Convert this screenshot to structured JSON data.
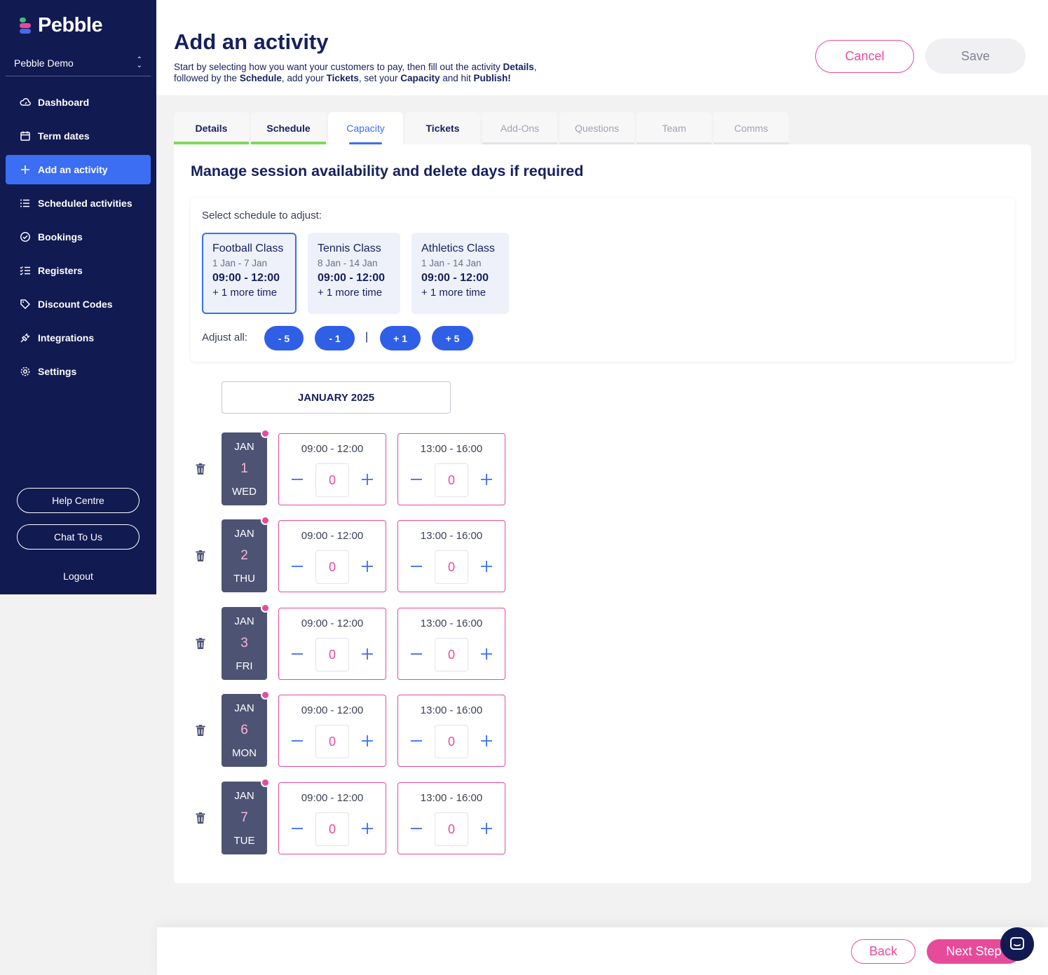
{
  "sidebar": {
    "logo_text": "Pebble",
    "org_name": "Pebble Demo",
    "items": [
      {
        "label": "Dashboard",
        "icon": "cloud-icon"
      },
      {
        "label": "Term dates",
        "icon": "calendar-icon"
      },
      {
        "label": "Add an activity",
        "icon": "plus-icon"
      },
      {
        "label": "Scheduled activities",
        "icon": "list-icon"
      },
      {
        "label": "Bookings",
        "icon": "check-circle-icon"
      },
      {
        "label": "Registers",
        "icon": "checklist-icon"
      },
      {
        "label": "Discount Codes",
        "icon": "tag-icon"
      },
      {
        "label": "Integrations",
        "icon": "plug-icon"
      },
      {
        "label": "Settings",
        "icon": "gear-icon"
      }
    ],
    "help_label": "Help Centre",
    "chat_label": "Chat To Us",
    "logout_label": "Logout"
  },
  "header": {
    "title": "Add an activity",
    "desc_1": "Start by selecting how you want your customers to pay, then fill out the activity ",
    "desc_b1": "Details",
    "desc_2": ",",
    "desc_3": "followed by the ",
    "desc_b2": "Schedule",
    "desc_4": ", add your ",
    "desc_b3": "Tickets",
    "desc_5": ", set your ",
    "desc_b4": "Capacity",
    "desc_6": " and hit ",
    "desc_b5": "Publish!",
    "cancel_label": "Cancel",
    "save_label": "Save"
  },
  "tabs": [
    "Details",
    "Schedule",
    "Capacity",
    "Tickets",
    "Add-Ons",
    "Questions",
    "Team",
    "Comms"
  ],
  "main": {
    "title": "Manage session availability and delete days if required",
    "select_label": "Select schedule to adjust:",
    "schedules": [
      {
        "name": "Football Class",
        "dates": "1 Jan - 7 Jan",
        "time": "09:00 - 12:00",
        "more": "+ 1 more time"
      },
      {
        "name": "Tennis Class",
        "dates": "8 Jan - 14 Jan",
        "time": "09:00 - 12:00",
        "more": "+ 1 more time"
      },
      {
        "name": "Athletics Class",
        "dates": "1 Jan - 14 Jan",
        "time": "09:00 - 12:00",
        "more": "+ 1 more time"
      }
    ],
    "adjust_label": "Adjust all:",
    "adjust_buttons": [
      "- 5",
      "- 1",
      "+ 1",
      "+ 5"
    ],
    "separator": "|",
    "month": "JANUARY 2025",
    "days": [
      {
        "month": "JAN",
        "day": "1",
        "weekday": "WED",
        "slots": [
          {
            "time": "09:00 - 12:00",
            "value": "0"
          },
          {
            "time": "13:00 - 16:00",
            "value": "0"
          }
        ]
      },
      {
        "month": "JAN",
        "day": "2",
        "weekday": "THU",
        "slots": [
          {
            "time": "09:00 - 12:00",
            "value": "0"
          },
          {
            "time": "13:00 - 16:00",
            "value": "0"
          }
        ]
      },
      {
        "month": "JAN",
        "day": "3",
        "weekday": "FRI",
        "slots": [
          {
            "time": "09:00 - 12:00",
            "value": "0"
          },
          {
            "time": "13:00 - 16:00",
            "value": "0"
          }
        ]
      },
      {
        "month": "JAN",
        "day": "6",
        "weekday": "MON",
        "slots": [
          {
            "time": "09:00 - 12:00",
            "value": "0"
          },
          {
            "time": "13:00 - 16:00",
            "value": "0"
          }
        ]
      },
      {
        "month": "JAN",
        "day": "7",
        "weekday": "TUE",
        "slots": [
          {
            "time": "09:00 - 12:00",
            "value": "0"
          },
          {
            "time": "13:00 - 16:00",
            "value": "0"
          }
        ]
      }
    ]
  },
  "footer": {
    "back_label": "Back",
    "next_label": "Next Step"
  },
  "colors": {
    "sidebar_bg": "#121a52",
    "accent_blue": "#3b6ef2",
    "accent_pink": "#e84a9a",
    "tab_done": "#7ed957"
  }
}
